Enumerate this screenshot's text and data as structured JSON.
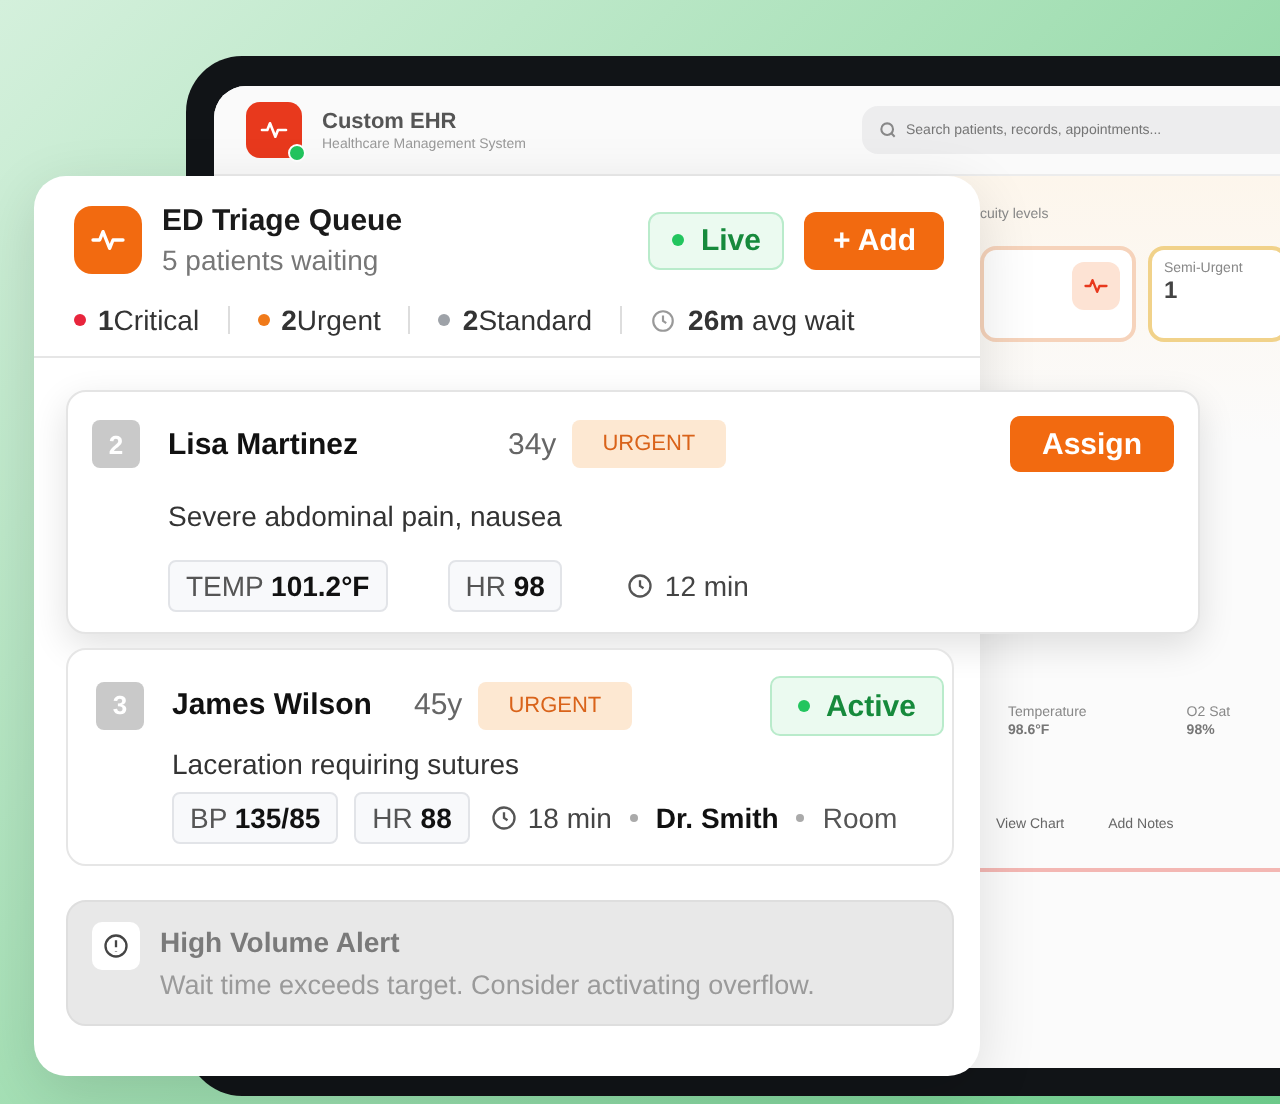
{
  "background_app": {
    "title": "Custom EHR",
    "subtitle": "Healthcare Management System",
    "online": true,
    "search": {
      "placeholder": "Search patients, records, appointments..."
    },
    "section_label": "cuity levels",
    "cards": [
      {
        "kind": "icon"
      },
      {
        "kind": "count",
        "label": "Semi-Urgent",
        "value": "1"
      }
    ],
    "vitals": [
      {
        "label": "Temperature",
        "value": "98.6°F"
      },
      {
        "label": "O2 Sat",
        "value": "98%"
      }
    ],
    "actions": [
      "View Chart",
      "Add Notes"
    ]
  },
  "queue": {
    "title": "ED Triage Queue",
    "subtitle": "5 patients waiting",
    "live": {
      "label": "Live",
      "on": true
    },
    "add_button": "+ Add",
    "stats": [
      {
        "count": "1",
        "label": "Critical",
        "color": "#e8253c"
      },
      {
        "count": "2",
        "label": "Urgent",
        "color": "#f07a1a"
      },
      {
        "count": "2",
        "label": "Standard",
        "color": "#9ea2a8"
      }
    ],
    "wait": {
      "value": "26m",
      "label": "avg wait"
    }
  },
  "patients": [
    {
      "number": "2",
      "name": "Lisa Martinez",
      "age": "34y",
      "priority": "URGENT",
      "complaint": "Severe abdominal pain, nausea",
      "vitals": [
        {
          "label": "TEMP",
          "value": "101.2°F"
        },
        {
          "label": "HR",
          "value": "98"
        }
      ],
      "wait": "12 min",
      "action": {
        "kind": "assign",
        "label": "Assign"
      },
      "raised": true
    },
    {
      "number": "3",
      "name": "James Wilson",
      "age": "45y",
      "priority": "URGENT",
      "complaint": "Laceration requiring sutures",
      "vitals": [
        {
          "label": "BP",
          "value": "135/85"
        },
        {
          "label": "HR",
          "value": "88"
        }
      ],
      "wait": "18 min",
      "doctor": "Dr. Smith",
      "room": "Room",
      "action": {
        "kind": "status",
        "label": "Active"
      },
      "raised": false
    }
  ],
  "alert": {
    "title": "High Volume Alert",
    "message": "Wait time exceeds target. Consider activating overflow."
  }
}
